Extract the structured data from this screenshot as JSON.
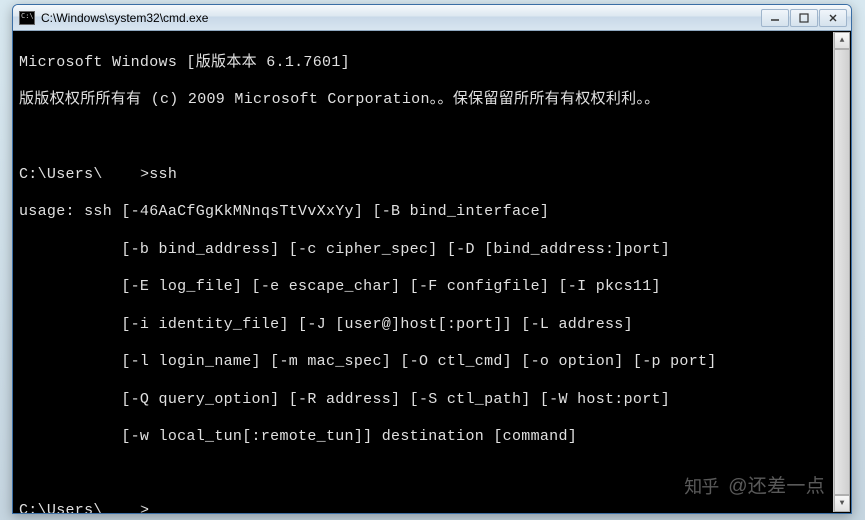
{
  "window": {
    "title": "C:\\Windows\\system32\\cmd.exe"
  },
  "terminal": {
    "line1": "Microsoft Windows [版版本本 6.1.7601]",
    "line2": "版版权权所所有有 (c) 2009 Microsoft Corporation。。保保留留所所有有权权利利。。",
    "blank1": "",
    "prompt1_pre": "C:\\Users\\",
    "prompt1_redact": "████",
    "prompt1_post": ">ssh",
    "usage1": "usage: ssh [-46AaCfGgKkMNnqsTtVvXxYy] [-B bind_interface]",
    "usage2": "           [-b bind_address] [-c cipher_spec] [-D [bind_address:]port]",
    "usage3": "           [-E log_file] [-e escape_char] [-F configfile] [-I pkcs11]",
    "usage4": "           [-i identity_file] [-J [user@]host[:port]] [-L address]",
    "usage5": "           [-l login_name] [-m mac_spec] [-O ctl_cmd] [-o option] [-p port]",
    "usage6": "           [-Q query_option] [-R address] [-S ctl_path] [-W host:port]",
    "usage7": "           [-w local_tun[:remote_tun]] destination [command]",
    "blank2": "",
    "prompt2_pre": "C:\\Users\\",
    "prompt2_redact": "████",
    "prompt2_post": ">"
  },
  "watermark": {
    "logo": "知乎",
    "text": "@还差一点"
  }
}
